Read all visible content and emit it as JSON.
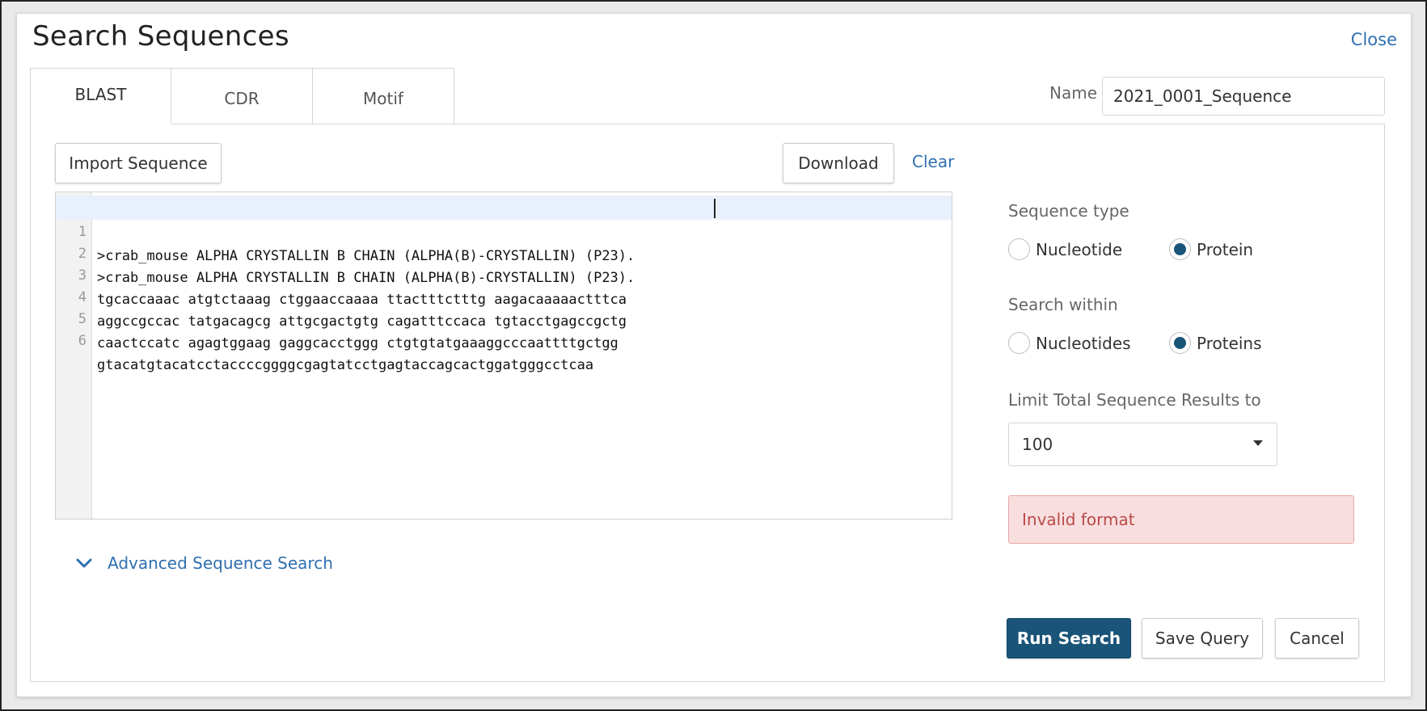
{
  "modal": {
    "title": "Search Sequences",
    "close_label": "Close"
  },
  "tabs": [
    {
      "label": "BLAST",
      "active": true
    },
    {
      "label": "CDR",
      "active": false
    },
    {
      "label": "Motif",
      "active": false
    }
  ],
  "name_field": {
    "label": "Name",
    "value": "2021_0001_Sequence"
  },
  "toolbar": {
    "import_label": "Import Sequence",
    "download_label": "Download",
    "clear_label": "Clear"
  },
  "editor": {
    "lines": [
      {
        "num": "1",
        "text": ">crab_mouse ALPHA CRYSTALLIN B CHAIN (ALPHA(B)-CRYSTALLIN) (P23)."
      },
      {
        "num": "2",
        "text": ">crab_mouse ALPHA CRYSTALLIN B CHAIN (ALPHA(B)-CRYSTALLIN) (P23)."
      },
      {
        "num": "3",
        "text": "tgcaccaaac atgtctaaag ctggaaccaaaa ttactttctttg aagacaaaaactttca"
      },
      {
        "num": "4",
        "text": "aggccgccac tatgacagcg attgcgactgtg cagatttccaca tgtacctgagccgctg"
      },
      {
        "num": "5",
        "text": "caactccatc agagtggaag gaggcacctggg ctgtgtatgaaaggcccaattttgctgg"
      },
      {
        "num": "6",
        "text": "gtacatgtacatcctaccccggggcgagtatcctgagtaccagcactggatgggcctcaa"
      }
    ]
  },
  "advanced": {
    "label": "Advanced Sequence Search"
  },
  "sequence_type": {
    "label": "Sequence type",
    "options": [
      {
        "label": "Nucleotide",
        "checked": false
      },
      {
        "label": "Protein",
        "checked": true
      }
    ]
  },
  "search_within": {
    "label": "Search within",
    "options": [
      {
        "label": "Nucleotides",
        "checked": false
      },
      {
        "label": "Proteins",
        "checked": true
      }
    ]
  },
  "limit": {
    "label": "Limit Total Sequence Results to",
    "value": "100"
  },
  "error": {
    "message": "Invalid format"
  },
  "footer": {
    "run_label": "Run Search",
    "save_label": "Save Query",
    "cancel_label": "Cancel"
  },
  "colors": {
    "primary": "#1a5478",
    "link": "#2f6fb0",
    "error_bg": "#f8dedf",
    "error_text": "#b94a48"
  }
}
